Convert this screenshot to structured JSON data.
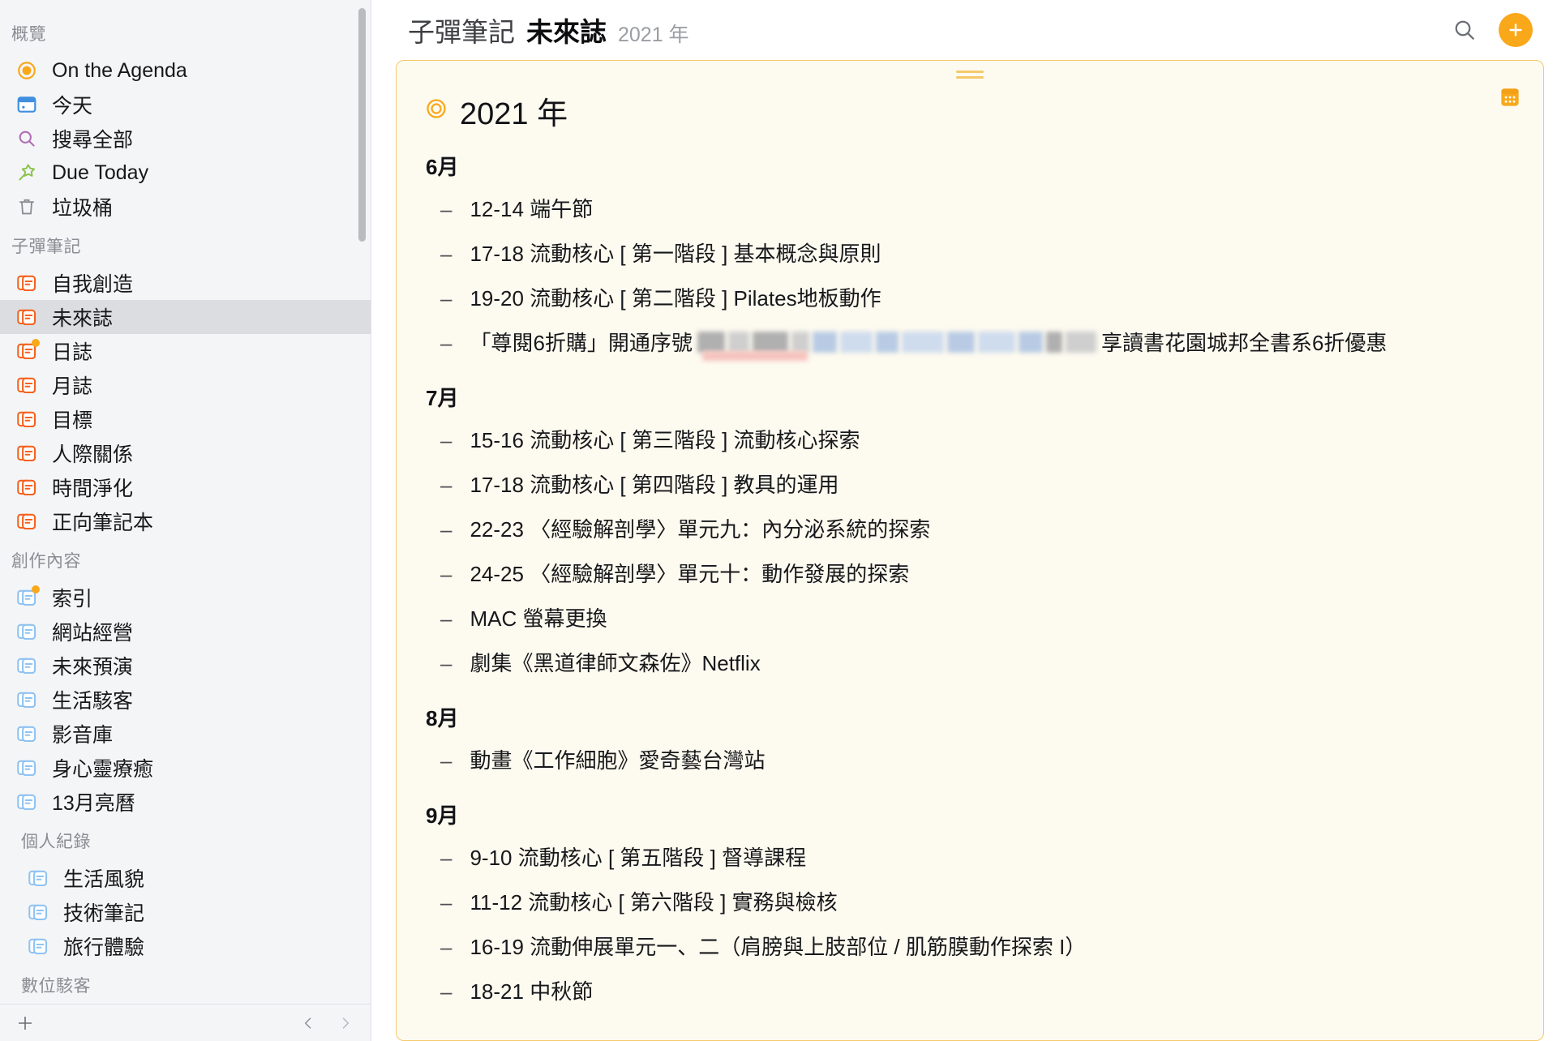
{
  "sidebar": {
    "sections": [
      {
        "title": "概覽",
        "indent": false,
        "items": [
          {
            "label": "On the Agenda",
            "icon": "target-dot-icon",
            "color": "#f9a81a",
            "badge": false,
            "selected": false
          },
          {
            "label": "今天",
            "icon": "calendar-icon",
            "color": "#3f8ee0",
            "badge": false,
            "selected": false
          },
          {
            "label": "搜尋全部",
            "icon": "search-icon",
            "color": "#b06ab3",
            "badge": false,
            "selected": false
          },
          {
            "label": "Due Today",
            "icon": "pin-star-icon",
            "color": "#8bc34a",
            "badge": false,
            "selected": false
          },
          {
            "label": "垃圾桶",
            "icon": "trash-icon",
            "color": "#8a8d93",
            "badge": false,
            "selected": false
          }
        ]
      },
      {
        "title": "子彈筆記",
        "indent": false,
        "items": [
          {
            "label": "自我創造",
            "icon": "notes-stack-icon",
            "color": "#f4621f",
            "badge": false,
            "selected": false
          },
          {
            "label": "未來誌",
            "icon": "notes-stack-icon",
            "color": "#f4621f",
            "badge": false,
            "selected": true
          },
          {
            "label": "日誌",
            "icon": "notes-stack-icon",
            "color": "#f4621f",
            "badge": true,
            "selected": false
          },
          {
            "label": "月誌",
            "icon": "notes-stack-icon",
            "color": "#f4621f",
            "badge": false,
            "selected": false
          },
          {
            "label": "目標",
            "icon": "notes-stack-icon",
            "color": "#f4621f",
            "badge": false,
            "selected": false
          },
          {
            "label": "人際關係",
            "icon": "notes-stack-icon",
            "color": "#f4621f",
            "badge": false,
            "selected": false
          },
          {
            "label": "時間淨化",
            "icon": "notes-stack-icon",
            "color": "#f4621f",
            "badge": false,
            "selected": false
          },
          {
            "label": "正向筆記本",
            "icon": "notes-stack-icon",
            "color": "#f4621f",
            "badge": false,
            "selected": false
          }
        ]
      },
      {
        "title": "創作內容",
        "indent": false,
        "items": [
          {
            "label": "索引",
            "icon": "notes-stack-icon",
            "color": "#8fc3f2",
            "badge": true,
            "selected": false
          },
          {
            "label": "網站經營",
            "icon": "notes-stack-icon",
            "color": "#8fc3f2",
            "badge": false,
            "selected": false
          },
          {
            "label": "未來預演",
            "icon": "notes-stack-icon",
            "color": "#8fc3f2",
            "badge": false,
            "selected": false
          },
          {
            "label": "生活駭客",
            "icon": "notes-stack-icon",
            "color": "#8fc3f2",
            "badge": false,
            "selected": false
          },
          {
            "label": "影音庫",
            "icon": "notes-stack-icon",
            "color": "#8fc3f2",
            "badge": false,
            "selected": false
          },
          {
            "label": "身心靈療癒",
            "icon": "notes-stack-icon",
            "color": "#8fc3f2",
            "badge": false,
            "selected": false
          },
          {
            "label": "13月亮曆",
            "icon": "notes-stack-icon",
            "color": "#8fc3f2",
            "badge": false,
            "selected": false
          }
        ]
      },
      {
        "title": "個人紀錄",
        "indent": true,
        "items": [
          {
            "label": "生活風貌",
            "icon": "notes-stack-icon",
            "color": "#8fc3f2",
            "badge": false,
            "selected": false,
            "indent": true
          },
          {
            "label": "技術筆記",
            "icon": "notes-stack-icon",
            "color": "#8fc3f2",
            "badge": false,
            "selected": false,
            "indent": true
          },
          {
            "label": "旅行體驗",
            "icon": "notes-stack-icon",
            "color": "#8fc3f2",
            "badge": false,
            "selected": false,
            "indent": true
          }
        ]
      },
      {
        "title": "數位駭客",
        "indent": true,
        "items": []
      }
    ],
    "bottom": {
      "add_label": "add-list-button",
      "prev_label": "previous-button",
      "next_label": "next-button"
    }
  },
  "header": {
    "breadcrumb": "子彈筆記",
    "title": "未來誌",
    "subtitle": "2021 年",
    "search_icon": "search-icon",
    "add_icon": "plus-icon",
    "accent_color": "#f9a81a"
  },
  "card": {
    "title": "2021 年",
    "title_icon": "target-circle-icon",
    "calendar_icon": "calendar-icon",
    "border_color": "#f5c96a",
    "background_color": "#fdfaf0",
    "months": [
      {
        "name": "6月",
        "entries": [
          {
            "text": "12-14 端午節"
          },
          {
            "text": "17-18 流動核心 [ 第一階段 ] 基本概念與原則"
          },
          {
            "text": "19-20 流動核心 [ 第二階段 ] Pilates地板動作"
          },
          {
            "text_before": "「尊閱6折購」開通序號",
            "redacted": true,
            "text_after": "享讀書花園城邦全書系6折優惠"
          }
        ]
      },
      {
        "name": "7月",
        "entries": [
          {
            "text": "15-16 流動核心 [ 第三階段 ] 流動核心探索"
          },
          {
            "text": "17-18 流動核心 [ 第四階段 ] 教具的運用"
          },
          {
            "text": "22-23 〈經驗解剖學〉單元九：內分泌系統的探索"
          },
          {
            "text": "24-25 〈經驗解剖學〉單元十：動作發展的探索"
          },
          {
            "text": "MAC 螢幕更換"
          },
          {
            "text": "劇集《黑道律師文森佐》Netflix"
          }
        ]
      },
      {
        "name": "8月",
        "entries": [
          {
            "text": "動畫《工作細胞》愛奇藝台灣站"
          }
        ]
      },
      {
        "name": "9月",
        "entries": [
          {
            "text": "9-10 流動核心 [ 第五階段 ] 督導課程"
          },
          {
            "text": "11-12 流動核心 [ 第六階段 ] 實務與檢核"
          },
          {
            "text": "16-19 流動伸展單元一、二（肩膀與上肢部位 / 肌筋膜動作探索 I）"
          },
          {
            "text": "18-21 中秋節"
          }
        ]
      }
    ]
  }
}
